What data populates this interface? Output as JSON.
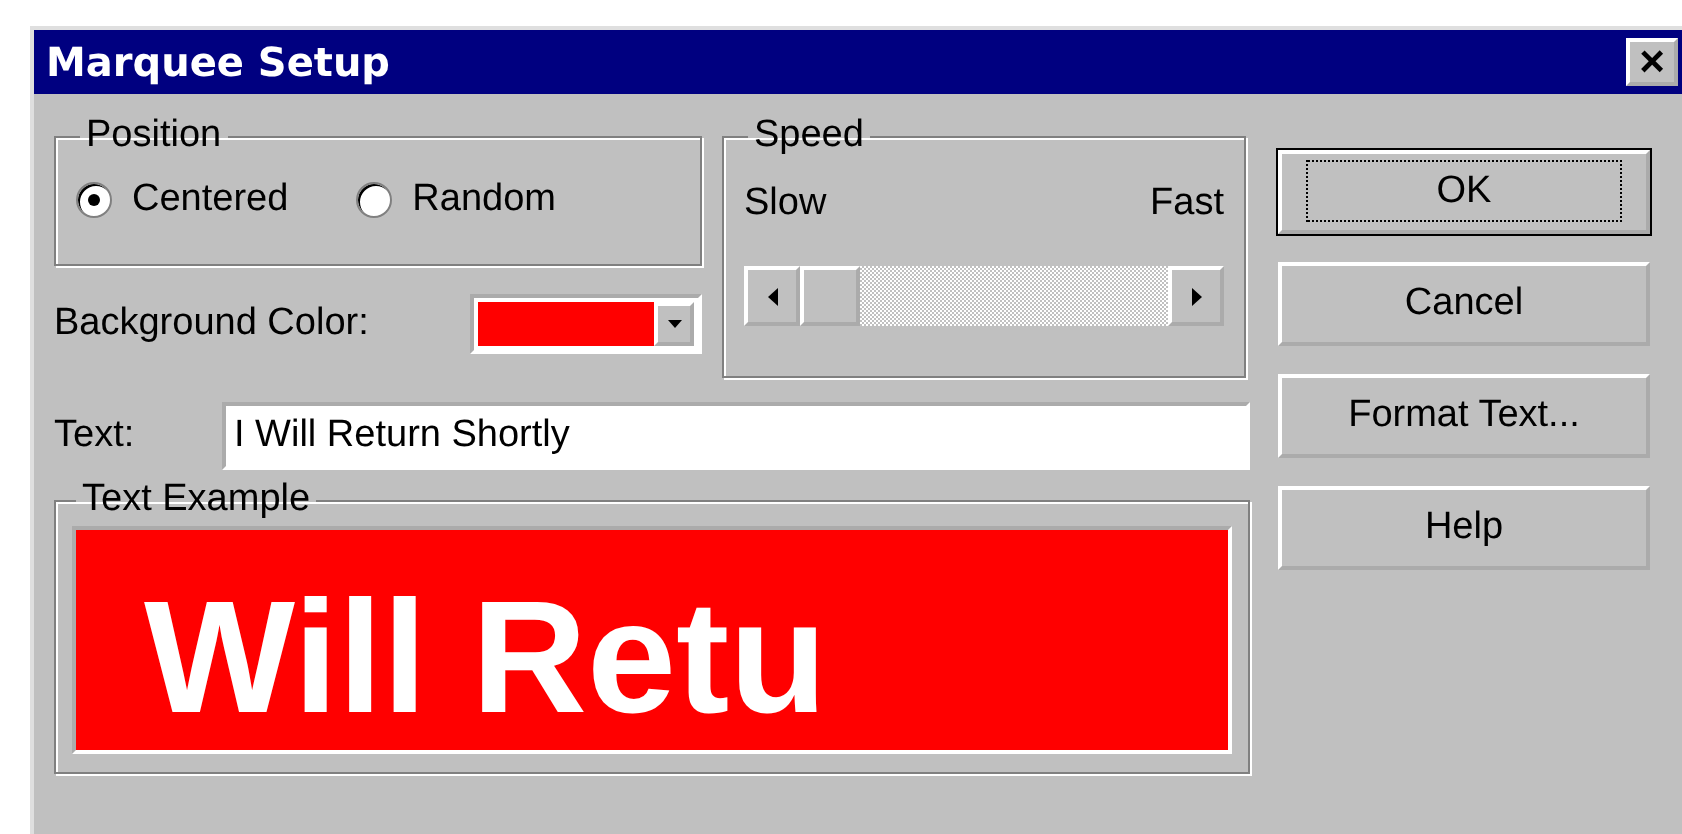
{
  "window": {
    "title": "Marquee Setup",
    "close_glyph": "×"
  },
  "position": {
    "label": "Position",
    "options": [
      {
        "label": "Centered",
        "selected": true
      },
      {
        "label": "Random",
        "selected": false
      }
    ]
  },
  "speed": {
    "label": "Speed",
    "min_label": "Slow",
    "max_label": "Fast"
  },
  "background_color": {
    "label": "Background Color:",
    "color": "#ff0000"
  },
  "text_field": {
    "label": "Text:",
    "value": "I Will Return Shortly"
  },
  "text_example": {
    "label": "Text Example",
    "preview": "Will Retu"
  },
  "buttons": [
    {
      "label": "OK",
      "default": true
    },
    {
      "label": "Cancel",
      "default": false
    },
    {
      "label": "Format Text...",
      "default": false
    },
    {
      "label": "Help",
      "default": false
    }
  ]
}
